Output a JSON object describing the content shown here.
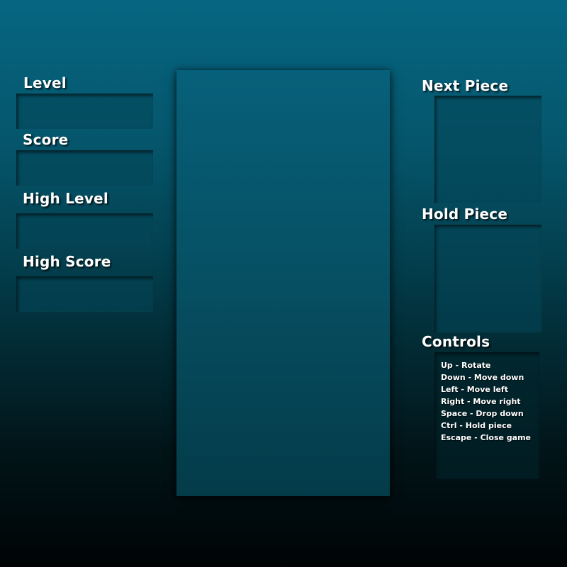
{
  "left_panel": {
    "level_label": "Level",
    "score_label": "Score",
    "high_level_label": "High Level",
    "high_score_label": "High Score"
  },
  "right_panel": {
    "next_piece_label": "Next Piece",
    "hold_piece_label": "Hold Piece",
    "controls_label": "Controls",
    "controls": [
      "Up  -  Rotate",
      "Down - Move down",
      "Left - Move left",
      "Right - Move right",
      "Space - Drop down",
      "Ctrl - Hold piece",
      "Escape - Close game"
    ]
  },
  "colors": {
    "background_top": "#066681",
    "background_bottom": "#000405",
    "board": "#064f62",
    "text": "#ffffff"
  }
}
